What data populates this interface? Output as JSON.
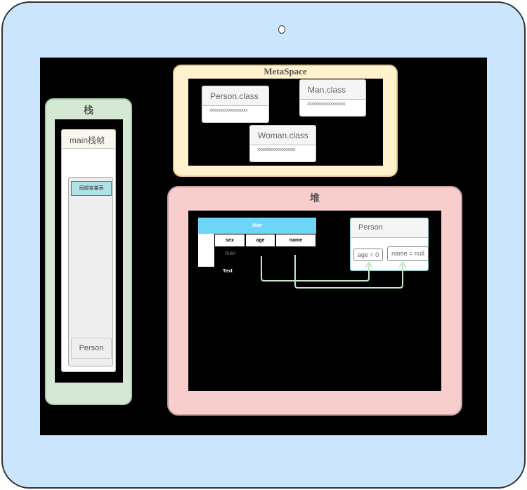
{
  "stack": {
    "title": "栈",
    "frame_title": "main栈帧",
    "local_vars": "局部变量表",
    "person_slot": "Person"
  },
  "metaspace": {
    "title": "MetaSpace",
    "classes": [
      {
        "name": "Person.class",
        "body": "xxxxxxxxxxxxxxxxxx"
      },
      {
        "name": "Man.class",
        "body": "xxxxxxxxxxxxxxxxxx"
      },
      {
        "name": "Woman.class",
        "body": "xxxxxxxxxxxxxxxxxx"
      }
    ]
  },
  "heap": {
    "title": "堆",
    "man_table": {
      "title": "Man",
      "columns": [
        "sex",
        "age",
        "name"
      ],
      "value": "man",
      "caption": "Text"
    },
    "person": {
      "title": "Person",
      "fields": [
        "age = 0",
        "name = null"
      ]
    }
  },
  "colors": {
    "device": "#cce5ff",
    "stack": "#d5e8d4",
    "metaspace": "#fff2cc",
    "heap": "#f8cecc",
    "table_header": "#6cd5f8",
    "arrow": "#c7e6c7"
  }
}
